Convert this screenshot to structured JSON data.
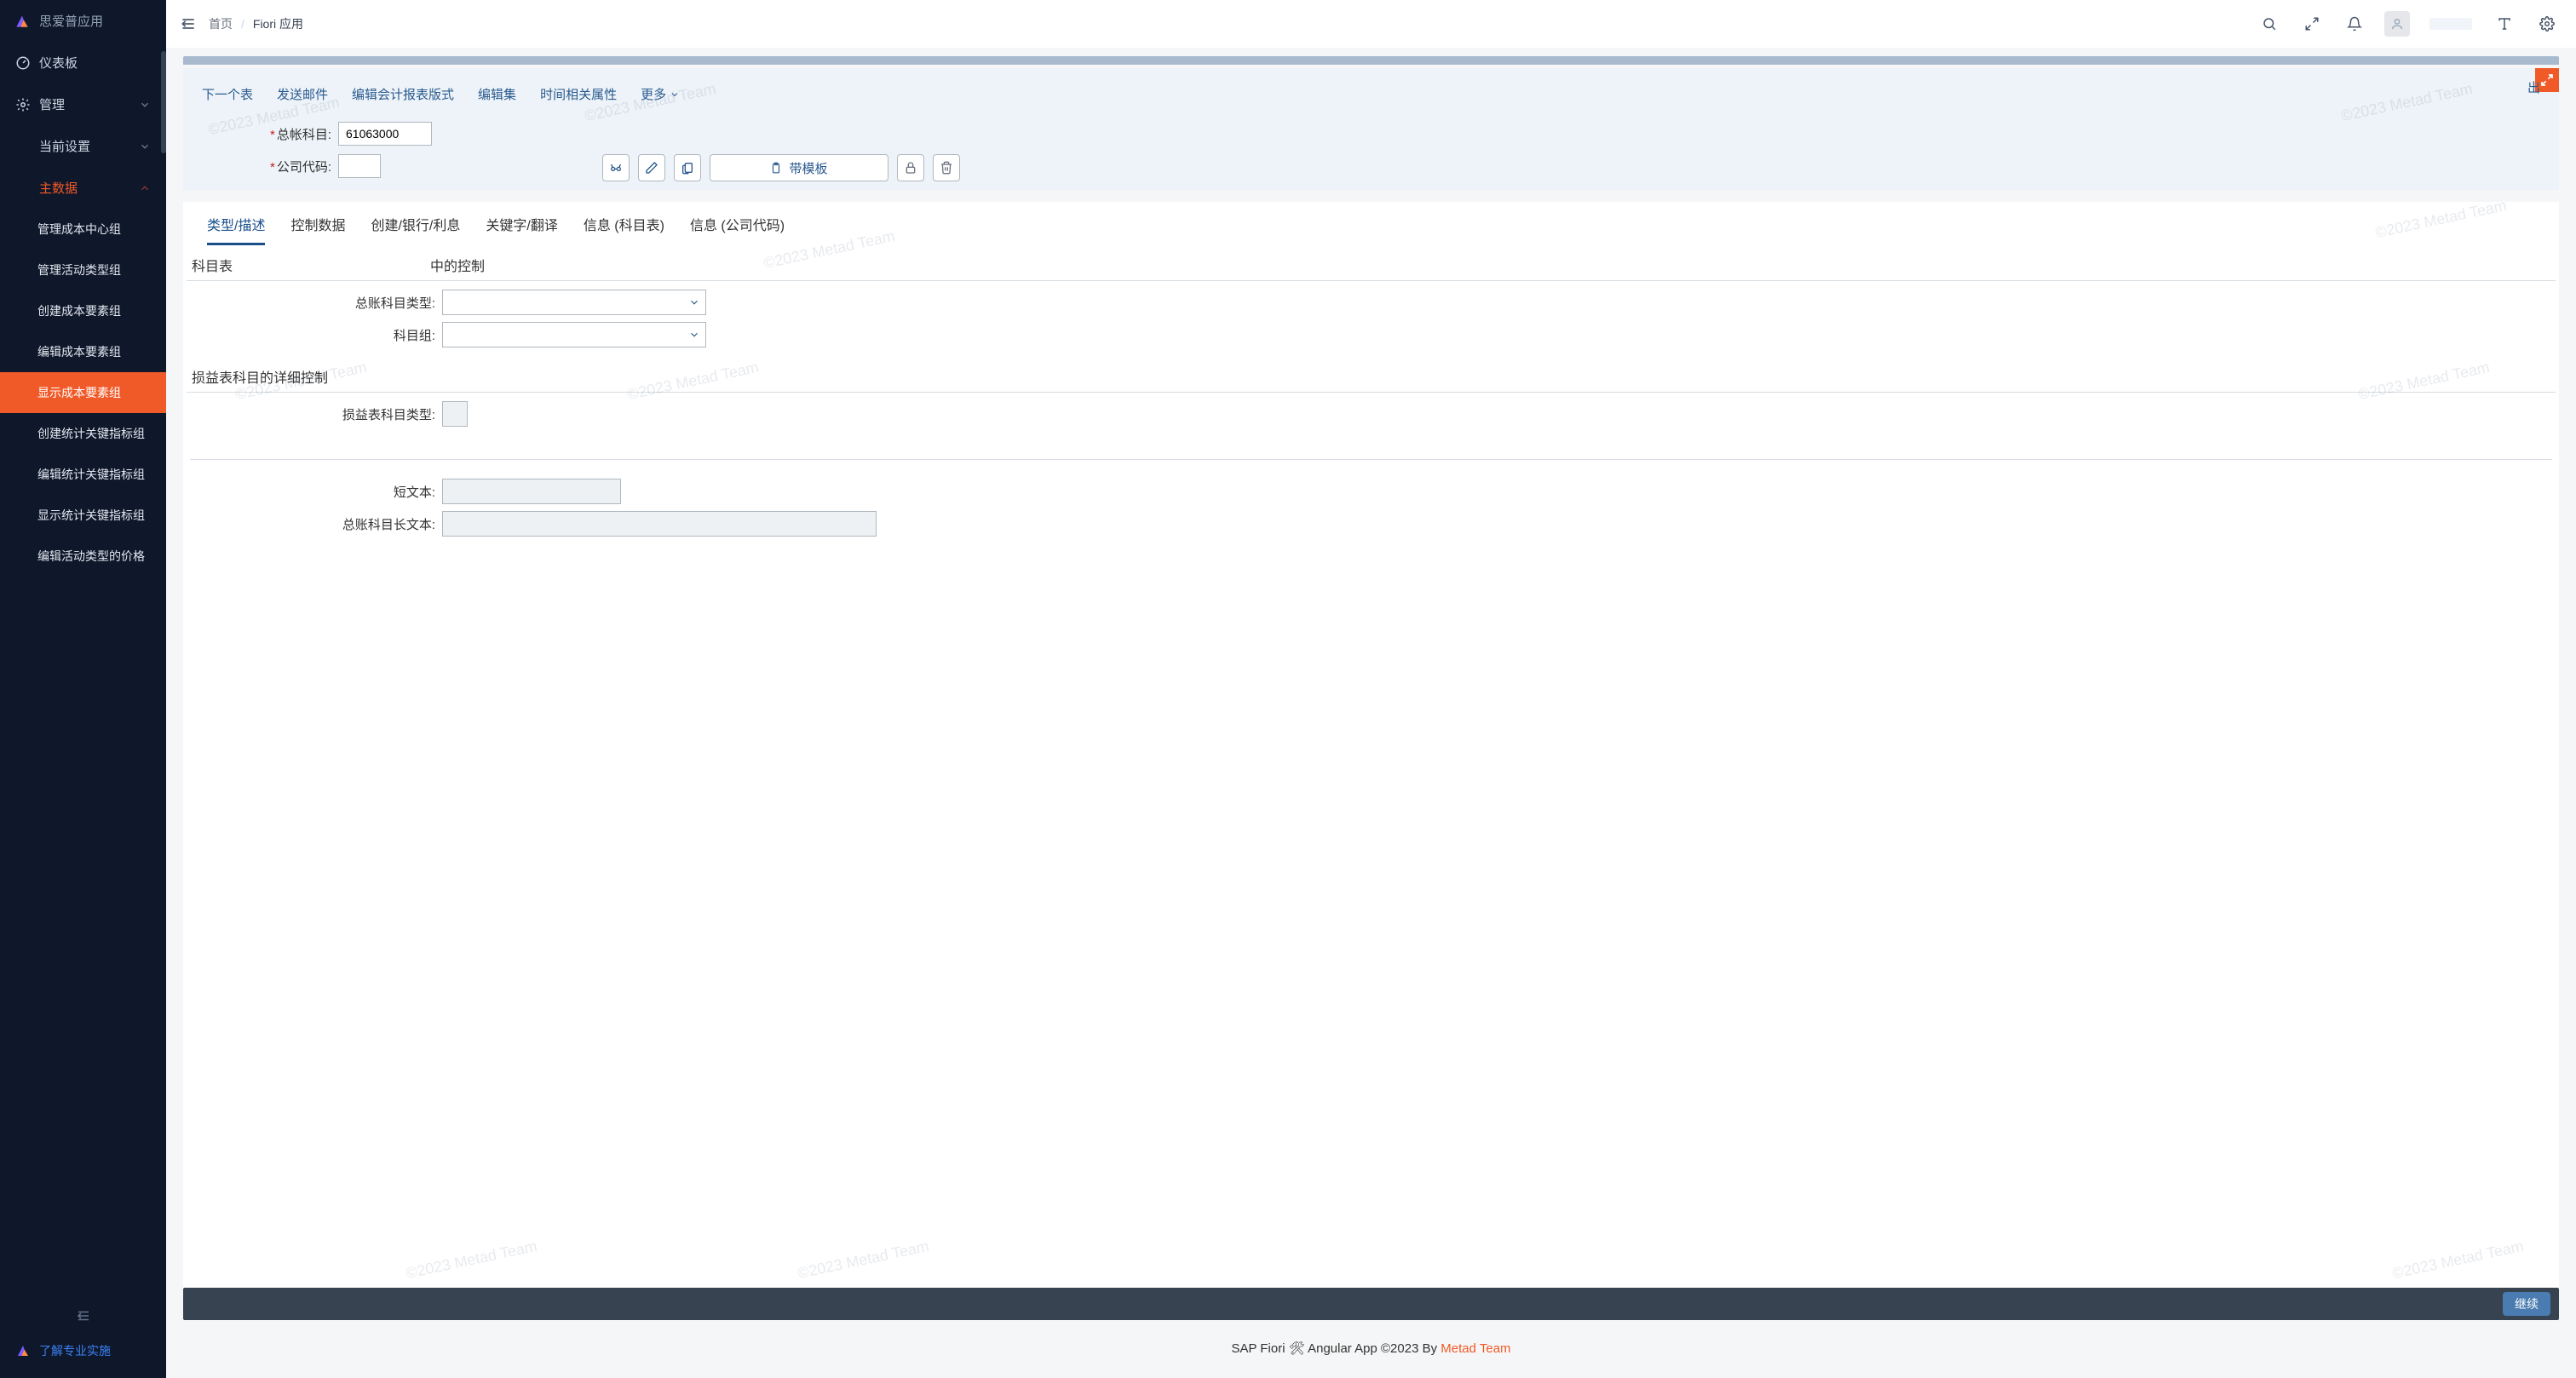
{
  "brand": "思爱普应用",
  "sidebar": {
    "items": [
      {
        "label": "仪表板",
        "icon": "gauge-icon",
        "expandable": false
      },
      {
        "label": "管理",
        "icon": "gear-icon",
        "expandable": true
      },
      {
        "label": "当前设置",
        "icon": "",
        "expandable": true
      },
      {
        "label": "主数据",
        "icon": "",
        "expandable": true,
        "active_parent": true
      }
    ],
    "subitems": [
      {
        "label": "管理成本中心组"
      },
      {
        "label": "管理活动类型组"
      },
      {
        "label": "创建成本要素组"
      },
      {
        "label": "编辑成本要素组"
      },
      {
        "label": "显示成本要素组",
        "active": true
      },
      {
        "label": "创建统计关键指标组"
      },
      {
        "label": "编辑统计关键指标组"
      },
      {
        "label": "显示统计关键指标组"
      },
      {
        "label": "编辑活动类型的价格"
      }
    ],
    "bottom_link": "了解专业实施"
  },
  "breadcrumb": {
    "home": "首页",
    "current": "Fiori 应用"
  },
  "panel": {
    "toolbar": {
      "next_table": "下一个表",
      "send_mail": "发送邮件",
      "edit_report_format": "编辑会计报表版式",
      "edit_set": "编辑集",
      "time_attrs": "时间相关属性",
      "more": "更多"
    },
    "exit_label": "出",
    "fields": {
      "gl_account_label": "总帐科目:",
      "gl_account_value": "61063000",
      "company_code_label": "公司代码:",
      "company_code_value": ""
    },
    "action_buttons": {
      "template_label": "带模板"
    }
  },
  "tabs": [
    {
      "label": "类型/描述",
      "active": true
    },
    {
      "label": "控制数据"
    },
    {
      "label": "创建/银行/利息"
    },
    {
      "label": "关键字/翻译"
    },
    {
      "label": "信息 (科目表)"
    },
    {
      "label": "信息 (公司代码)"
    }
  ],
  "section": {
    "header_left": "科目表",
    "header_mid": "中的控制",
    "gl_type_label": "总账科目类型:",
    "account_group_label": "科目组:",
    "pl_detail_header": "损益表科目的详细控制",
    "pl_type_label": "损益表科目类型:",
    "short_text_label": "短文本:",
    "long_text_label": "总账科目长文本:"
  },
  "footer": {
    "continue": "继续"
  },
  "page_footer": {
    "prefix": "SAP Fiori 🛠 Angular App ©2023 By ",
    "brand": "Metad Team"
  },
  "watermark": "©2023 Metad Team"
}
